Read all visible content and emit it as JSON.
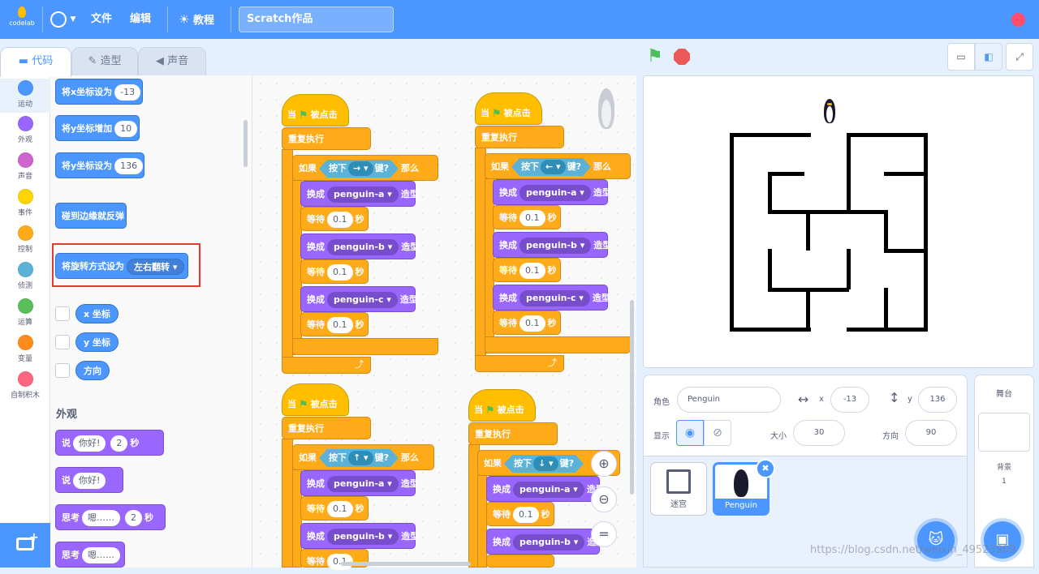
{
  "menubar": {
    "logo_text": "codelab",
    "globe_icon": "globe-icon",
    "file": "文件",
    "edit": "编辑",
    "tutorial": "教程",
    "project_title": "Scratch作品"
  },
  "tabs": {
    "code": "代码",
    "costumes": "造型",
    "sounds": "声音"
  },
  "categories": [
    {
      "label": "运动",
      "color": "#4c97ff"
    },
    {
      "label": "外观",
      "color": "#9966ff"
    },
    {
      "label": "声音",
      "color": "#cf63cf"
    },
    {
      "label": "事件",
      "color": "#ffd500"
    },
    {
      "label": "控制",
      "color": "#ffab19"
    },
    {
      "label": "侦测",
      "color": "#5cb1d6"
    },
    {
      "label": "运算",
      "color": "#59c059"
    },
    {
      "label": "变量",
      "color": "#ff8c1a"
    },
    {
      "label": "自制积木",
      "color": "#ff6680"
    }
  ],
  "palette": {
    "set_x": "将x坐标设为",
    "set_x_val": "-13",
    "change_y": "将y坐标增加",
    "change_y_val": "10",
    "set_y": "将y坐标设为",
    "set_y_val": "136",
    "bounce": "碰到边缘就反弹",
    "rotation": "将旋转方式设为",
    "rotation_val": "左右翻转",
    "x_pos": "x 坐标",
    "y_pos": "y 坐标",
    "direction": "方向",
    "looks_title": "外观",
    "say_for": "说",
    "say_for_text": "你好!",
    "say_for_secs": "2",
    "secs": "秒",
    "say": "说",
    "say_text": "你好!",
    "think_for": "思考",
    "think_for_text": "嗯……",
    "think_for_secs": "2",
    "think": "思考",
    "think_text": "嗯……"
  },
  "scripts": {
    "when": "当",
    "clicked": "被点击",
    "forever": "重复执行",
    "if": "如果",
    "key": "按下",
    "pressed": "键?",
    "then": "那么",
    "switch": "换成",
    "costume": "造型",
    "wait": "等待",
    "wait_val": "0.1",
    "sec": "秒",
    "costume_a": "penguin-a",
    "costume_b": "penguin-b",
    "costume_c": "penguin-c",
    "key_right": "→",
    "key_left": "←",
    "key_up": "↑",
    "key_down": "↓"
  },
  "sprite_info": {
    "sprite_label": "角色",
    "sprite_name": "Penguin",
    "x_label": "x",
    "x_val": "-13",
    "y_label": "y",
    "y_val": "136",
    "show_label": "显示",
    "size_label": "大小",
    "size_val": "30",
    "dir_label": "方向",
    "dir_val": "90"
  },
  "sprites": [
    {
      "name": "迷宫"
    },
    {
      "name": "Penguin"
    }
  ],
  "stage_pane": {
    "title": "舞台",
    "backdrops_label": "背景",
    "backdrops_count": "1"
  },
  "watermark": "https://blog.csdn.net/weixin_49523909"
}
